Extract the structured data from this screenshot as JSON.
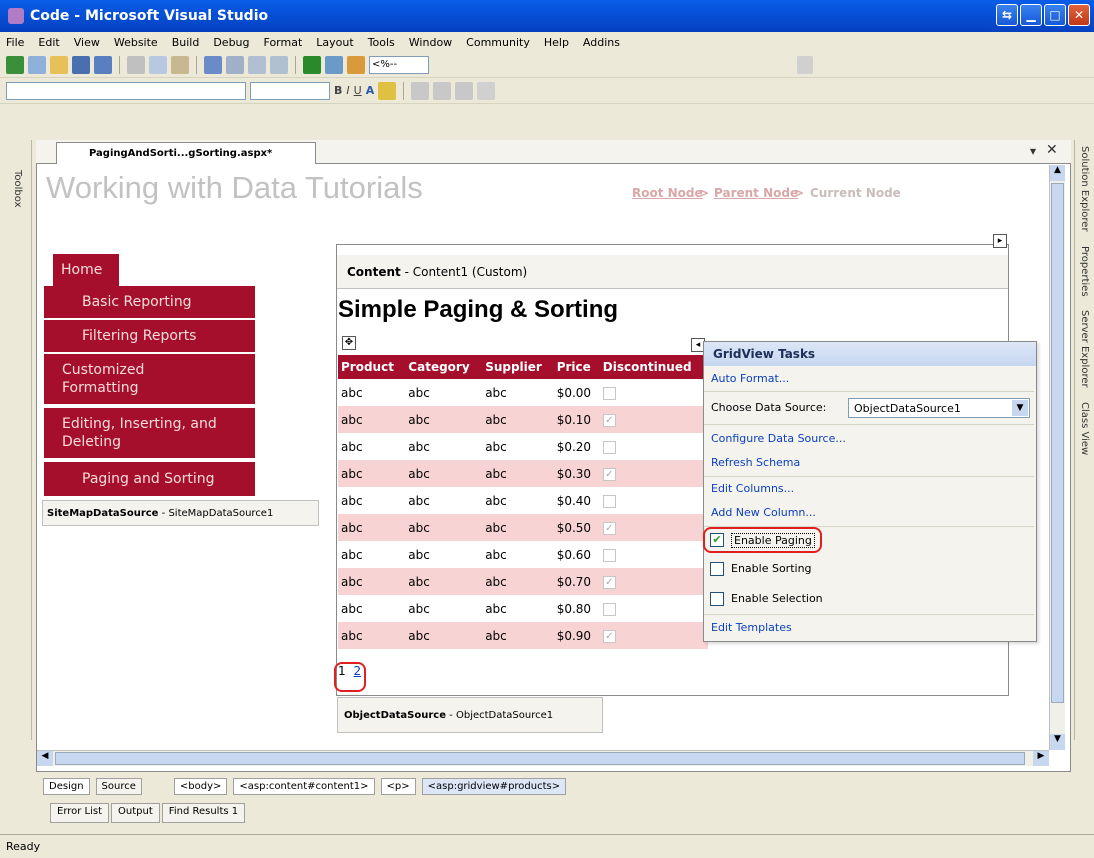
{
  "window": {
    "title": "Code - Microsoft Visual Studio"
  },
  "menu": [
    "File",
    "Edit",
    "View",
    "Website",
    "Build",
    "Debug",
    "Format",
    "Layout",
    "Tools",
    "Window",
    "Community",
    "Help",
    "Addins"
  ],
  "toolbar": {
    "block_combo_value": "<%--"
  },
  "document_tab": {
    "label": "PagingAndSorti...gSorting.aspx*"
  },
  "side_panels": {
    "left": "Toolbox",
    "right": [
      "Solution Explorer",
      "Properties",
      "Server Explorer",
      "Class View"
    ]
  },
  "page": {
    "site_title": "Working with Data Tutorials",
    "breadcrumb": {
      "root": "Root Node",
      "parent": "Parent Node",
      "separator": " > ",
      "current": "Current Node"
    },
    "nav": [
      "Home",
      "Basic Reporting",
      "Filtering Reports",
      "Customized Formatting",
      "Editing, Inserting, and Deleting",
      "Paging and Sorting"
    ],
    "sitemap_source": {
      "type": "SiteMapDataSource",
      "name": "SiteMapDataSource1"
    },
    "content_header": {
      "label": "Content",
      "detail": "Content1 (Custom)"
    },
    "heading": "Simple Paging & Sorting",
    "grid": {
      "columns": [
        "Product",
        "Category",
        "Supplier",
        "Price",
        "Discontinued"
      ],
      "rows": [
        {
          "product": "abc",
          "category": "abc",
          "supplier": "abc",
          "price": "$0.00",
          "checked": false
        },
        {
          "product": "abc",
          "category": "abc",
          "supplier": "abc",
          "price": "$0.10",
          "checked": true
        },
        {
          "product": "abc",
          "category": "abc",
          "supplier": "abc",
          "price": "$0.20",
          "checked": false
        },
        {
          "product": "abc",
          "category": "abc",
          "supplier": "abc",
          "price": "$0.30",
          "checked": true
        },
        {
          "product": "abc",
          "category": "abc",
          "supplier": "abc",
          "price": "$0.40",
          "checked": false
        },
        {
          "product": "abc",
          "category": "abc",
          "supplier": "abc",
          "price": "$0.50",
          "checked": true
        },
        {
          "product": "abc",
          "category": "abc",
          "supplier": "abc",
          "price": "$0.60",
          "checked": false
        },
        {
          "product": "abc",
          "category": "abc",
          "supplier": "abc",
          "price": "$0.70",
          "checked": true
        },
        {
          "product": "abc",
          "category": "abc",
          "supplier": "abc",
          "price": "$0.80",
          "checked": false
        },
        {
          "product": "abc",
          "category": "abc",
          "supplier": "abc",
          "price": "$0.90",
          "checked": true
        }
      ],
      "pager": {
        "current": "1",
        "next": "2"
      }
    },
    "object_source": {
      "type": "ObjectDataSource",
      "name": "ObjectDataSource1"
    }
  },
  "tasks_panel": {
    "title": "GridView Tasks",
    "auto_format": "Auto Format...",
    "choose_label": "Choose Data Source:",
    "choose_value": "ObjectDataSource1",
    "configure": "Configure Data Source...",
    "refresh": "Refresh Schema",
    "edit_columns": "Edit Columns...",
    "add_column": "Add New Column...",
    "enable_paging": {
      "label": "Enable Paging",
      "checked": true
    },
    "enable_sorting": {
      "label": "Enable Sorting",
      "checked": false
    },
    "enable_selection": {
      "label": "Enable Selection",
      "checked": false
    },
    "edit_templates": "Edit Templates"
  },
  "bottom": {
    "design_tab": "Design",
    "source_tab": "Source",
    "tags": [
      "<body>",
      "<asp:content#content1>",
      "<p>",
      "<asp:gridview#products>"
    ],
    "output_tabs": [
      "Error List",
      "Output",
      "Find Results 1"
    ]
  },
  "status": {
    "text": "Ready"
  }
}
